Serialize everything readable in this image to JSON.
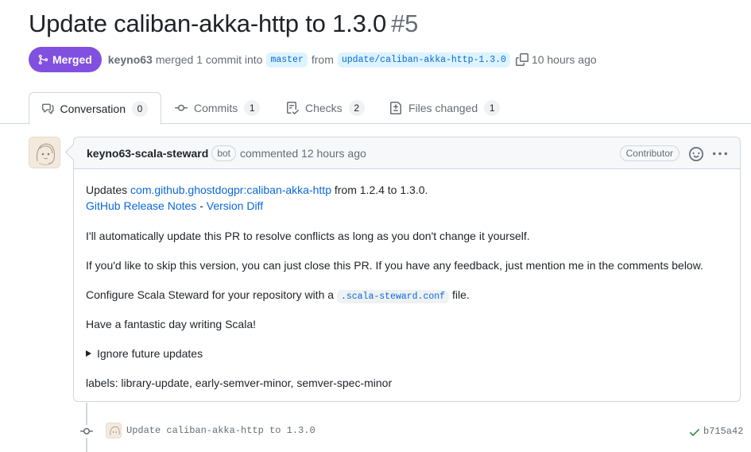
{
  "pr": {
    "title": "Update caliban-akka-http to 1.3.0",
    "number": "#5",
    "state": "Merged",
    "author": "keyno63",
    "merge_text": "merged 1 commit into",
    "base_branch": "master",
    "from_text": "from",
    "head_branch": "update/caliban-akka-http-1.3.0",
    "time": "10 hours ago"
  },
  "tabs": [
    {
      "label": "Conversation",
      "count": "0"
    },
    {
      "label": "Commits",
      "count": "1"
    },
    {
      "label": "Checks",
      "count": "2"
    },
    {
      "label": "Files changed",
      "count": "1"
    }
  ],
  "comment": {
    "author": "keyno63-scala-steward",
    "bot_label": "bot",
    "action": "commented 12 hours ago",
    "role": "Contributor",
    "line1_prefix": "Updates",
    "line1_link": "com.github.ghostdogpr:caliban-akka-http",
    "line1_suffix": "from 1.2.4 to 1.3.0.",
    "release_notes": "GitHub Release Notes",
    "separator": "-",
    "version_diff": "Version Diff",
    "para_auto": "I'll automatically update this PR to resolve conflicts as long as you don't change it yourself.",
    "para_skip": "If you'd like to skip this version, you can just close this PR. If you have any feedback, just mention me in the comments below.",
    "config_prefix": "Configure Scala Steward for your repository with a",
    "config_code": ".scala-steward.conf",
    "config_suffix": "file.",
    "para_day": "Have a fantastic day writing Scala!",
    "ignore_label": "Ignore future updates",
    "labels_line": "labels: library-update, early-semver-minor, semver-spec-minor"
  },
  "commit": {
    "message": "Update caliban-akka-http to 1.3.0",
    "sha": "b715a42",
    "status": "success"
  },
  "colors": {
    "merged": "#8250df",
    "link": "#0969da",
    "success": "#1a7f37"
  }
}
